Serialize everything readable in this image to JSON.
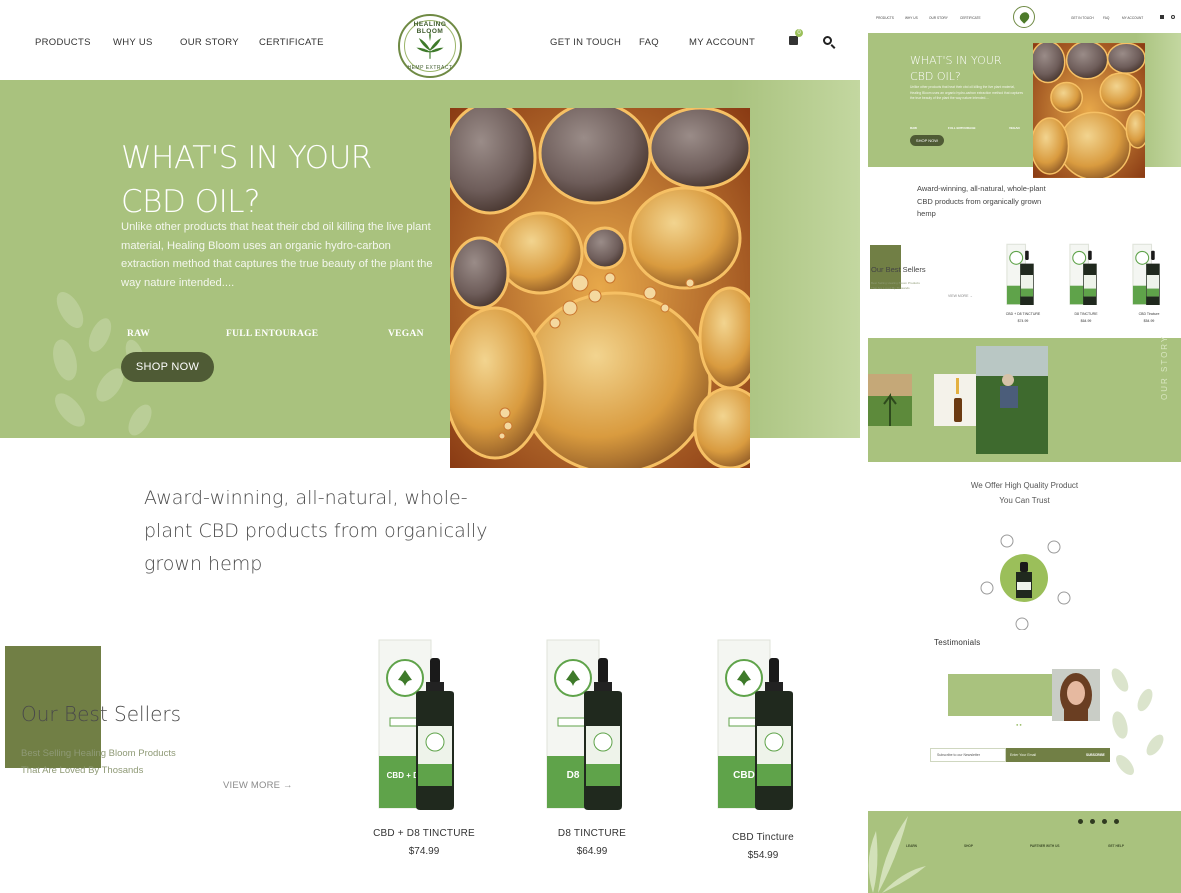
{
  "nav": {
    "left": [
      "PRODUCTS",
      "WHY US",
      "OUR STORY",
      "CERTIFICATE"
    ],
    "right": [
      "GET IN TOUCH",
      "FAQ",
      "MY ACCOUNT"
    ],
    "cart_count": "0",
    "logo_top": "HEALING BLOOM",
    "logo_bottom": "HEMP EXTRACT"
  },
  "hero": {
    "title_line1": "WHAT'S IN YOUR",
    "title_line2": "CBD OIL?",
    "description": "Unlike other products that heat their cbd oil killing the live plant material, Healing Bloom uses an organic hydro-carbon extraction method that captures the true beauty of the plant the way nature intended....",
    "tags": [
      "RAW",
      "FULL ENTOURAGE",
      "VEGAN"
    ],
    "cta": "SHOP NOW"
  },
  "tagline": "Award-winning, all-natural, whole-plant CBD products from organically grown hemp",
  "best_sellers": {
    "title": "Our Best Sellers",
    "subtitle_line1": "Best Selling Healing Bloom Products",
    "subtitle_line2": "That Are Loved By Thosands",
    "view_more": "VIEW MORE →",
    "products": [
      {
        "name": "CBD + D8 TINCTURE",
        "price": "$74.99",
        "label": "CBD + D8"
      },
      {
        "name": "D8 TINCTURE",
        "price": "$64.99",
        "label": "D8"
      },
      {
        "name": "CBD Tincture",
        "price": "$54.99",
        "label": "CBD"
      }
    ]
  },
  "thumb": {
    "story_label": "OUR STORY",
    "offer_line1": "We Offer High Quality Product",
    "offer_line2": "You Can Trust",
    "testimonials": "Testimonials",
    "newsletter_label": "Subscribe to our Newsletter",
    "newsletter_placeholder": "Enter Your Email",
    "newsletter_button": "SUBSCRIBE",
    "footer_heads": [
      "LEARN",
      "SHOP",
      "PARTNER WITH US",
      "GET HELP"
    ]
  },
  "colors": {
    "accent_green": "#a9c27e",
    "dark_olive": "#717f45",
    "button": "#4f5b35"
  }
}
